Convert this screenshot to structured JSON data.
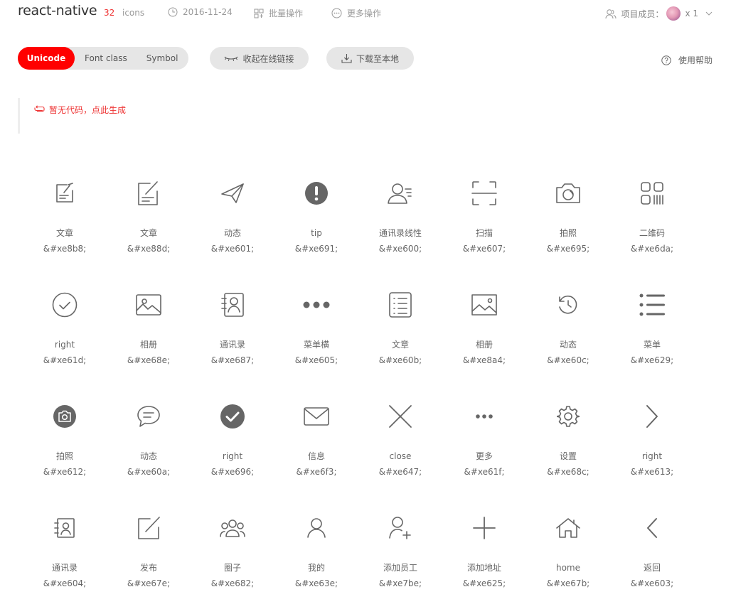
{
  "header": {
    "project_name": "react-native",
    "icon_count": "32",
    "icon_count_label": "icons",
    "date": "2016-11-24",
    "batch_label": "批量操作",
    "more_label": "更多操作",
    "members_label": "项目成员：",
    "members_count": "x 1"
  },
  "toolbar": {
    "tabs": [
      "Unicode",
      "Font class",
      "Symbol"
    ],
    "active_tab": "Unicode",
    "collapse_label": "收起在线链接",
    "download_label": "下载至本地",
    "help_label": "使用帮助"
  },
  "code_box": {
    "text": "暂无代码，点此生成"
  },
  "colors": {
    "accent": "#ff0000",
    "icon": "#666666"
  },
  "icons": [
    {
      "name": "文章",
      "code": "&#xe8b8;",
      "icon": "article-icon"
    },
    {
      "name": "文章",
      "code": "&#xe88d;",
      "icon": "article-edit-icon"
    },
    {
      "name": "动态",
      "code": "&#xe601;",
      "icon": "paper-plane-icon"
    },
    {
      "name": "tip",
      "code": "&#xe691;",
      "icon": "alert-icon"
    },
    {
      "name": "通讯录线性",
      "code": "&#xe600;",
      "icon": "contact-list-icon"
    },
    {
      "name": "扫描",
      "code": "&#xe607;",
      "icon": "scan-icon"
    },
    {
      "name": "拍照",
      "code": "&#xe695;",
      "icon": "camera-icon"
    },
    {
      "name": "二维码",
      "code": "&#xe6da;",
      "icon": "qrcode-icon"
    },
    {
      "name": "right",
      "code": "&#xe61d;",
      "icon": "check-circle-icon"
    },
    {
      "name": "相册",
      "code": "&#xe68e;",
      "icon": "picture-icon"
    },
    {
      "name": "通讯录",
      "code": "&#xe687;",
      "icon": "address-book-icon"
    },
    {
      "name": "菜单横",
      "code": "&#xe605;",
      "icon": "dots-horizontal-icon"
    },
    {
      "name": "文章",
      "code": "&#xe60b;",
      "icon": "list-doc-icon"
    },
    {
      "name": "相册",
      "code": "&#xe8a4;",
      "icon": "image-icon"
    },
    {
      "name": "动态",
      "code": "&#xe60c;",
      "icon": "history-icon"
    },
    {
      "name": "菜单",
      "code": "&#xe629;",
      "icon": "menu-list-icon"
    },
    {
      "name": "拍照",
      "code": "&#xe612;",
      "icon": "camera-filled-icon"
    },
    {
      "name": "动态",
      "code": "&#xe60a;",
      "icon": "chat-bubble-icon"
    },
    {
      "name": "right",
      "code": "&#xe696;",
      "icon": "check-filled-icon"
    },
    {
      "name": "信息",
      "code": "&#xe6f3;",
      "icon": "mail-icon"
    },
    {
      "name": "close",
      "code": "&#xe647;",
      "icon": "close-icon"
    },
    {
      "name": "更多",
      "code": "&#xe61f;",
      "icon": "more-dots-icon"
    },
    {
      "name": "设置",
      "code": "&#xe68c;",
      "icon": "gear-icon"
    },
    {
      "name": "right",
      "code": "&#xe613;",
      "icon": "chevron-right-icon"
    },
    {
      "name": "通讯录",
      "code": "&#xe604;",
      "icon": "contact-card-icon"
    },
    {
      "name": "发布",
      "code": "&#xe67e;",
      "icon": "publish-icon"
    },
    {
      "name": "圈子",
      "code": "&#xe682;",
      "icon": "group-icon"
    },
    {
      "name": "我的",
      "code": "&#xe63e;",
      "icon": "user-icon"
    },
    {
      "name": "添加员工",
      "code": "&#xe7be;",
      "icon": "add-user-icon"
    },
    {
      "name": "添加地址",
      "code": "&#xe625;",
      "icon": "plus-icon"
    },
    {
      "name": "home",
      "code": "&#xe67b;",
      "icon": "home-icon"
    },
    {
      "name": "返回",
      "code": "&#xe603;",
      "icon": "chevron-left-icon"
    }
  ]
}
